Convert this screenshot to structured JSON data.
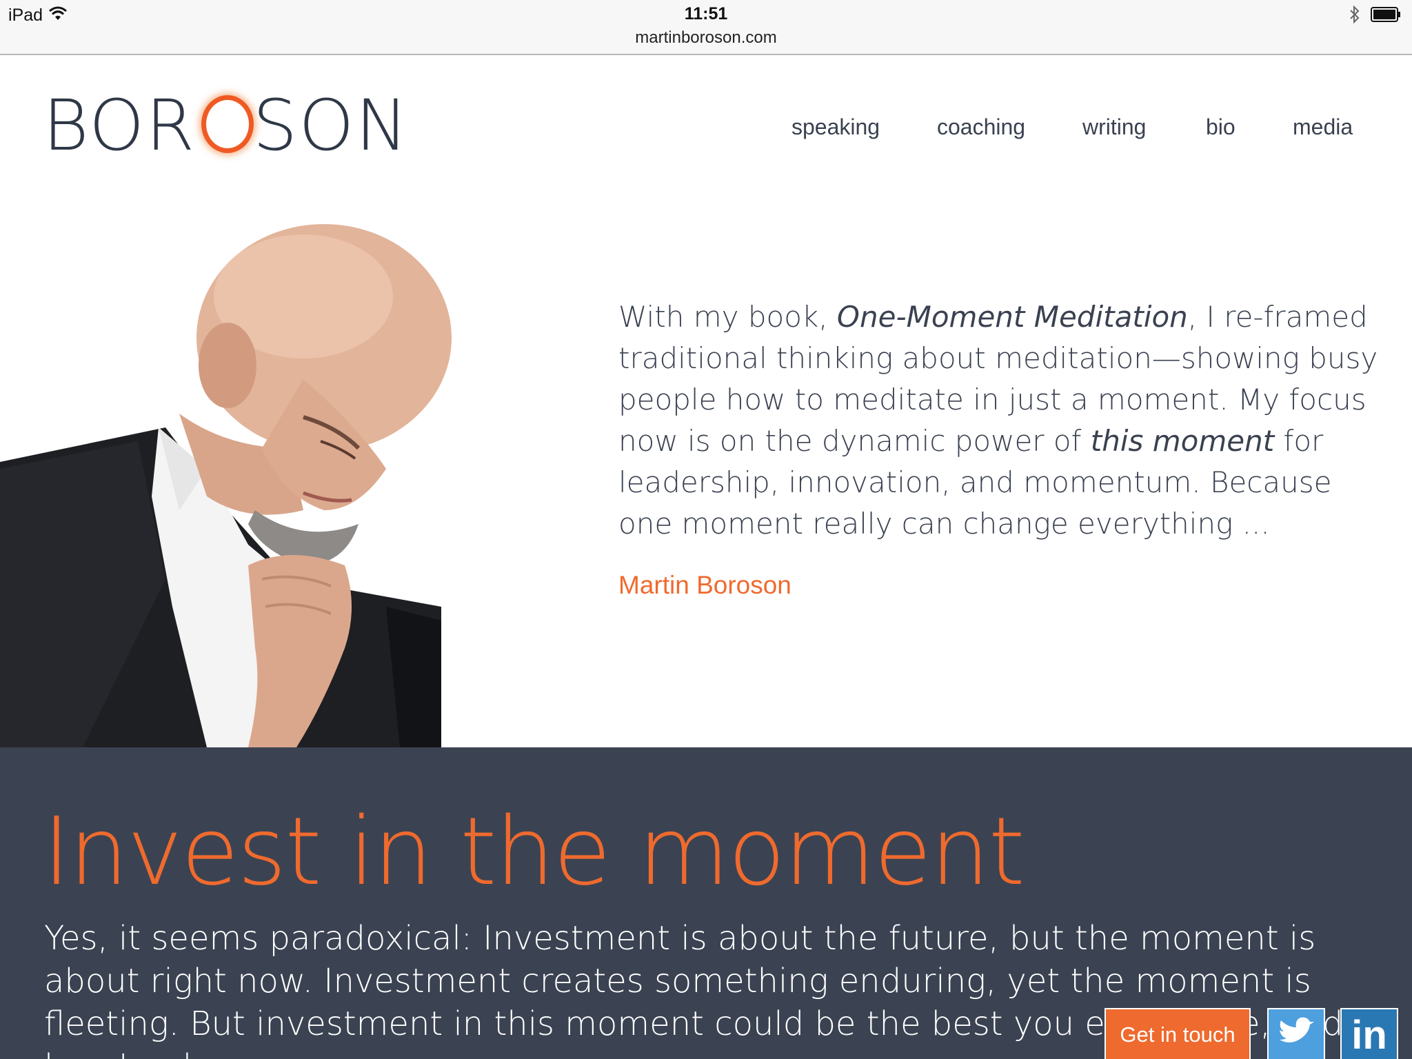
{
  "status_bar": {
    "device": "iPad",
    "time": "11:51",
    "url": "martinboroson.com"
  },
  "header": {
    "logo_text": "BOROSON",
    "nav": [
      "speaking",
      "coaching",
      "writing",
      "bio",
      "media"
    ]
  },
  "hero": {
    "quote_part1": "With my book, ",
    "quote_book": "One-Moment Meditation",
    "quote_part2": ", I re-framed traditional thinking about meditation—showing busy people how to meditate in just a moment. My focus now is on the dynamic power of ",
    "quote_emph": "this moment",
    "quote_part3": " for leadership, innovation, and momentum. Because one moment really can change everything ...",
    "author": "Martin Boroson"
  },
  "band": {
    "title": "Invest in the moment",
    "text": "Yes, it seems paradoxical: Investment is about the future, but the moment is about right now. Investment creates something enduring, yet the moment is fleeting. But investment in this moment could be the best you ever make, and here's why."
  },
  "actions": {
    "cta_label": "Get in touch",
    "linkedin_label": "in"
  },
  "colors": {
    "accent": "#ef6a2e",
    "band_bg": "#3b4352",
    "text": "#3a4150",
    "twitter": "#4e9fde",
    "linkedin": "#2a78b3"
  }
}
